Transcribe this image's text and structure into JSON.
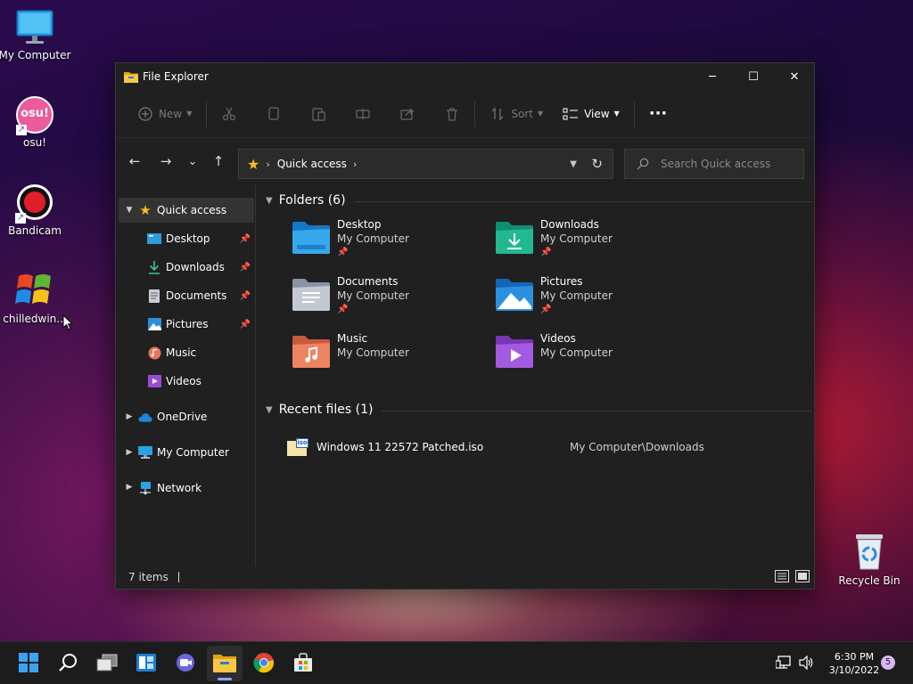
{
  "desktop": {
    "icons": [
      {
        "label": "My Computer"
      },
      {
        "label": "osu!",
        "glyph_text": "osu!"
      },
      {
        "label": "Bandicam"
      },
      {
        "label": "chilledwin..."
      },
      {
        "label": "Recycle Bin"
      }
    ]
  },
  "window": {
    "title": "File Explorer",
    "controls": {
      "minimize": "─",
      "maximize": "☐",
      "close": "✕"
    }
  },
  "toolbar": {
    "new_label": "New",
    "sort_label": "Sort",
    "view_label": "View",
    "more_label": "···"
  },
  "navigation": {
    "back": "←",
    "forward": "→",
    "recent": "⌄",
    "up": "↑"
  },
  "address": {
    "crumb": "Quick access",
    "sep": "›"
  },
  "search": {
    "placeholder": "Search Quick access"
  },
  "nav_pane": {
    "quick_access": "Quick access",
    "pinned": [
      {
        "label": "Desktop",
        "pinned": true
      },
      {
        "label": "Downloads",
        "pinned": true
      },
      {
        "label": "Documents",
        "pinned": true
      },
      {
        "label": "Pictures",
        "pinned": true
      },
      {
        "label": "Music",
        "pinned": false
      },
      {
        "label": "Videos",
        "pinned": false
      }
    ],
    "roots": [
      {
        "label": "OneDrive"
      },
      {
        "label": "My Computer"
      },
      {
        "label": "Network"
      }
    ]
  },
  "content": {
    "folders_header": "Folders (6)",
    "folders": [
      {
        "name": "Desktop",
        "location": "My Computer",
        "pinned": true,
        "icon": "desktop-folder-icon"
      },
      {
        "name": "Downloads",
        "location": "My Computer",
        "pinned": true,
        "icon": "downloads-folder-icon"
      },
      {
        "name": "Documents",
        "location": "My Computer",
        "pinned": true,
        "icon": "documents-folder-icon"
      },
      {
        "name": "Pictures",
        "location": "My Computer",
        "pinned": true,
        "icon": "pictures-folder-icon"
      },
      {
        "name": "Music",
        "location": "My Computer",
        "pinned": false,
        "icon": "music-folder-icon"
      },
      {
        "name": "Videos",
        "location": "My Computer",
        "pinned": false,
        "icon": "videos-folder-icon"
      }
    ],
    "recent_header": "Recent files (1)",
    "recent_files": [
      {
        "name": "Windows 11 22572 Patched.iso",
        "location": "My Computer\\Downloads",
        "badge": "iso"
      }
    ]
  },
  "status": {
    "item_count": "7 items"
  },
  "taskbar": {
    "time": "6:30 PM",
    "date": "3/10/2022",
    "notification_count": "5"
  },
  "colors": {
    "accent_folder": "#f2c01c",
    "window_bg": "#202020",
    "taskbar_bg": "#1c1c1c"
  }
}
